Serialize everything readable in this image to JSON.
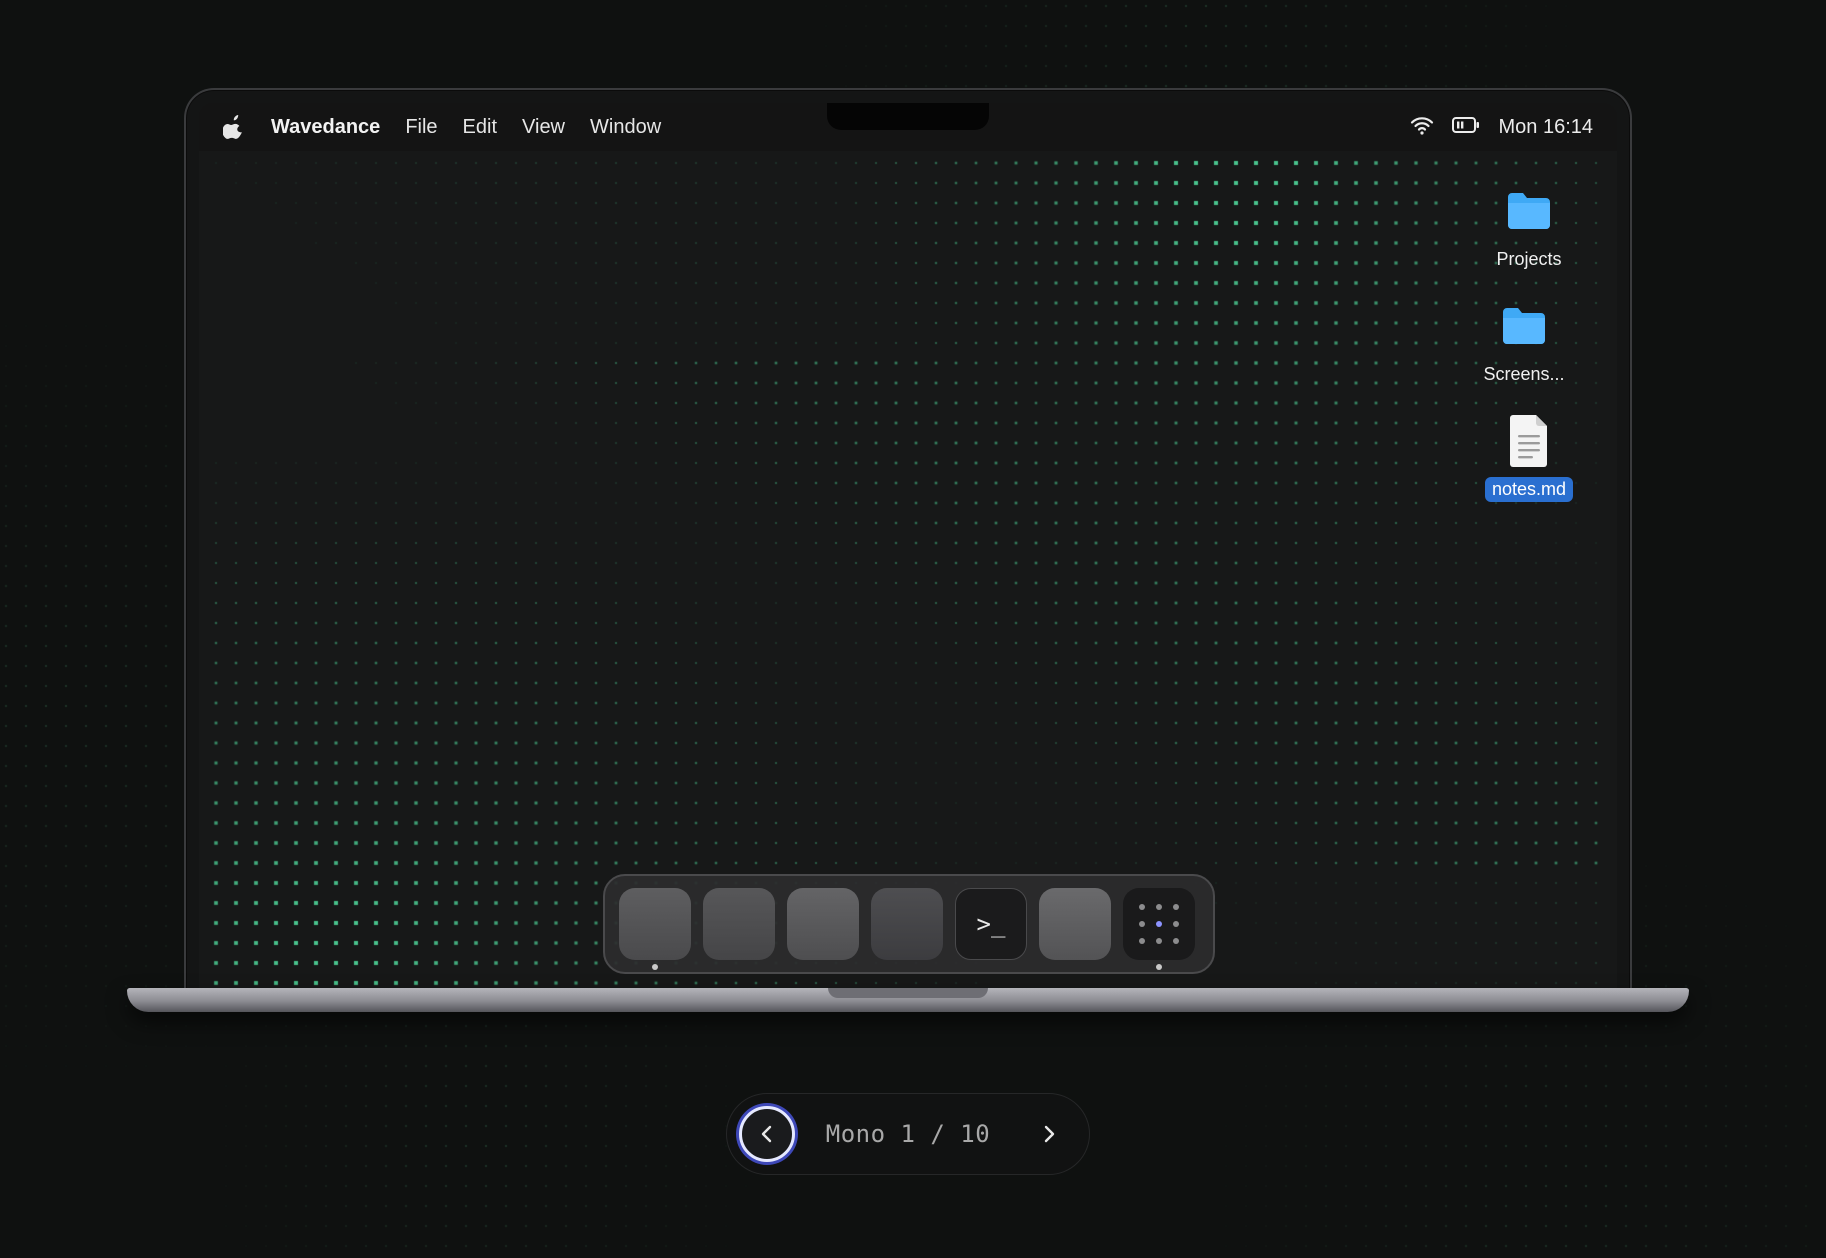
{
  "menubar": {
    "apple_icon": "apple-logo-icon",
    "app_name": "Wavedance",
    "items": [
      "File",
      "Edit",
      "View",
      "Window"
    ],
    "status_icons": [
      "wifi-icon",
      "battery-icon"
    ],
    "clock": "Mon 16:14"
  },
  "desktop": {
    "icons": [
      {
        "label": "Projects",
        "icon": "folder-icon",
        "selected": false
      },
      {
        "label": "Screens...",
        "icon": "folder-icon",
        "selected": false
      },
      {
        "label": "notes.md",
        "icon": "document-icon",
        "selected": true
      }
    ]
  },
  "dock": {
    "items": [
      {
        "name": "app-1",
        "running": true
      },
      {
        "name": "app-2",
        "running": false
      },
      {
        "name": "app-3",
        "running": false
      },
      {
        "name": "app-4",
        "running": false
      },
      {
        "name": "terminal",
        "glyph": ">_",
        "running": false
      },
      {
        "name": "app-6",
        "running": false
      },
      {
        "name": "launcher",
        "running": true
      }
    ]
  },
  "pager": {
    "label": "Mono 1 / 10",
    "prev_icon": "chevron-left-icon",
    "next_icon": "chevron-right-icon"
  },
  "colors": {
    "dot_accent": "#4fd69a",
    "folder": "#3fa9f5",
    "selection": "#2a6fd0",
    "focus_ring": "#3e48b8",
    "launcher_center_dot": "#8d93ff"
  }
}
